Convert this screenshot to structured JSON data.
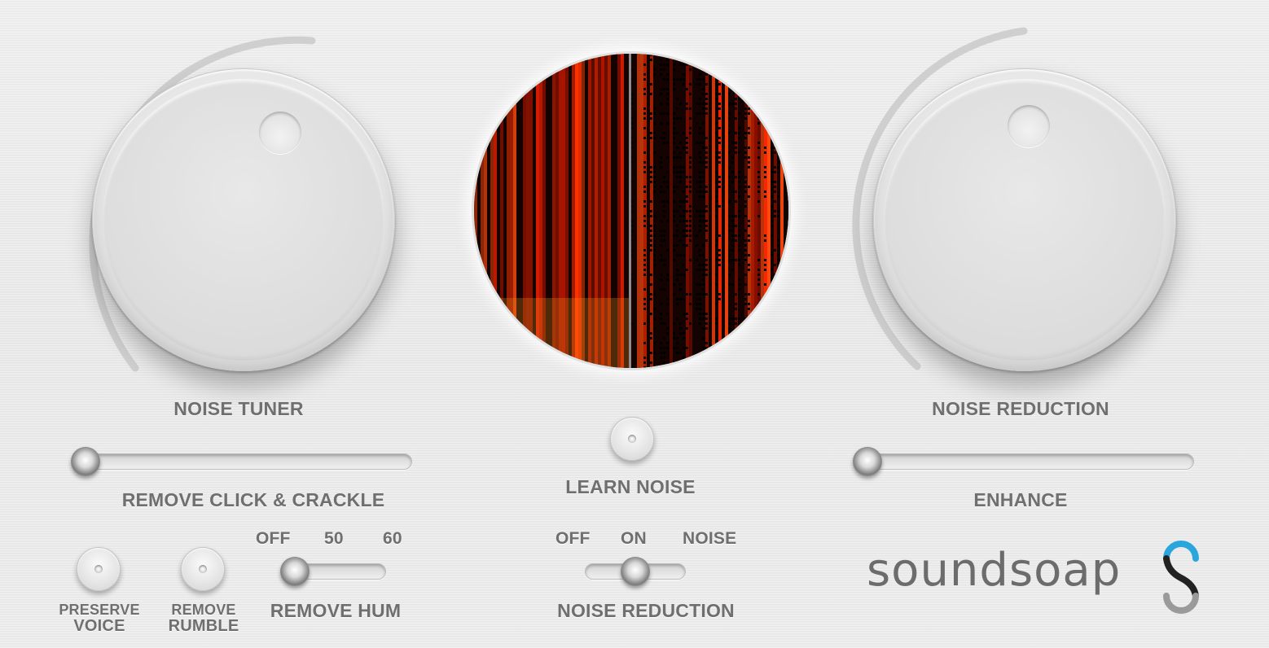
{
  "app": {
    "logo_text": "soundsoap"
  },
  "colors": {
    "accent": "#2aa6dc",
    "label": "#6f6f6f",
    "spectrum_hot": "#ff2a00"
  },
  "knobs": {
    "left": {
      "label": "NOISE TUNER"
    },
    "right": {
      "label": "NOISE REDUCTION"
    }
  },
  "sliders": {
    "click_crackle": {
      "label": "REMOVE CLICK & CRACKLE",
      "value": 0
    },
    "enhance": {
      "label": "ENHANCE",
      "value": 0
    },
    "hum": {
      "label": "REMOVE HUM",
      "options": [
        "OFF",
        "50",
        "60"
      ],
      "selected": "OFF"
    },
    "noise_reduction_mode": {
      "label": "NOISE REDUCTION",
      "options": [
        "OFF",
        "ON",
        "NOISE"
      ],
      "selected": "ON"
    }
  },
  "buttons": {
    "learn_noise": {
      "label": "LEARN NOISE"
    },
    "preserve_voice": {
      "line1": "PRESERVE",
      "line2": "VOICE"
    },
    "remove_rumble": {
      "line1": "REMOVE",
      "line2": "RUMBLE"
    }
  },
  "icons": {
    "logo_mark": "soundsoap-s-logo-icon"
  }
}
